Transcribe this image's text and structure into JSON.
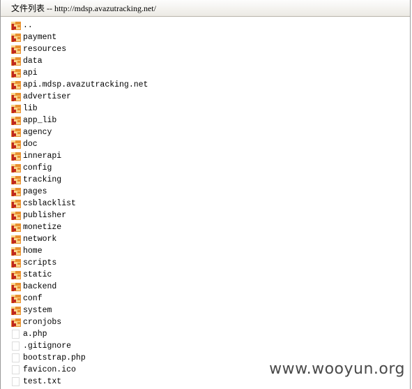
{
  "header": {
    "title": "文件列表 -- http://mdsp.avazutracking.net/"
  },
  "entries": [
    {
      "name": "..",
      "type": "folder"
    },
    {
      "name": "payment",
      "type": "folder"
    },
    {
      "name": "resources",
      "type": "folder"
    },
    {
      "name": "data",
      "type": "folder"
    },
    {
      "name": "api",
      "type": "folder"
    },
    {
      "name": "api.mdsp.avazutracking.net",
      "type": "folder"
    },
    {
      "name": "advertiser",
      "type": "folder"
    },
    {
      "name": "lib",
      "type": "folder"
    },
    {
      "name": "app_lib",
      "type": "folder"
    },
    {
      "name": "agency",
      "type": "folder"
    },
    {
      "name": "doc",
      "type": "folder"
    },
    {
      "name": "innerapi",
      "type": "folder"
    },
    {
      "name": "config",
      "type": "folder"
    },
    {
      "name": "tracking",
      "type": "folder"
    },
    {
      "name": "pages",
      "type": "folder"
    },
    {
      "name": "csblacklist",
      "type": "folder"
    },
    {
      "name": "publisher",
      "type": "folder"
    },
    {
      "name": "monetize",
      "type": "folder"
    },
    {
      "name": "network",
      "type": "folder"
    },
    {
      "name": "home",
      "type": "folder"
    },
    {
      "name": "scripts",
      "type": "folder"
    },
    {
      "name": "static",
      "type": "folder"
    },
    {
      "name": "backend",
      "type": "folder"
    },
    {
      "name": "conf",
      "type": "folder"
    },
    {
      "name": "system",
      "type": "folder"
    },
    {
      "name": "cronjobs",
      "type": "folder"
    },
    {
      "name": "a.php",
      "type": "file"
    },
    {
      "name": ".gitignore",
      "type": "file"
    },
    {
      "name": "bootstrap.php",
      "type": "file"
    },
    {
      "name": "favicon.ico",
      "type": "file"
    },
    {
      "name": "test.txt",
      "type": "file"
    }
  ],
  "icons": {
    "folder": "folder-icon",
    "file": "file-icon"
  },
  "colors": {
    "folder_orange": "#e8902e",
    "folder_red": "#c0281e",
    "folder_light": "#fbd58a"
  },
  "watermark": {
    "text": "www.wooyun.org"
  }
}
